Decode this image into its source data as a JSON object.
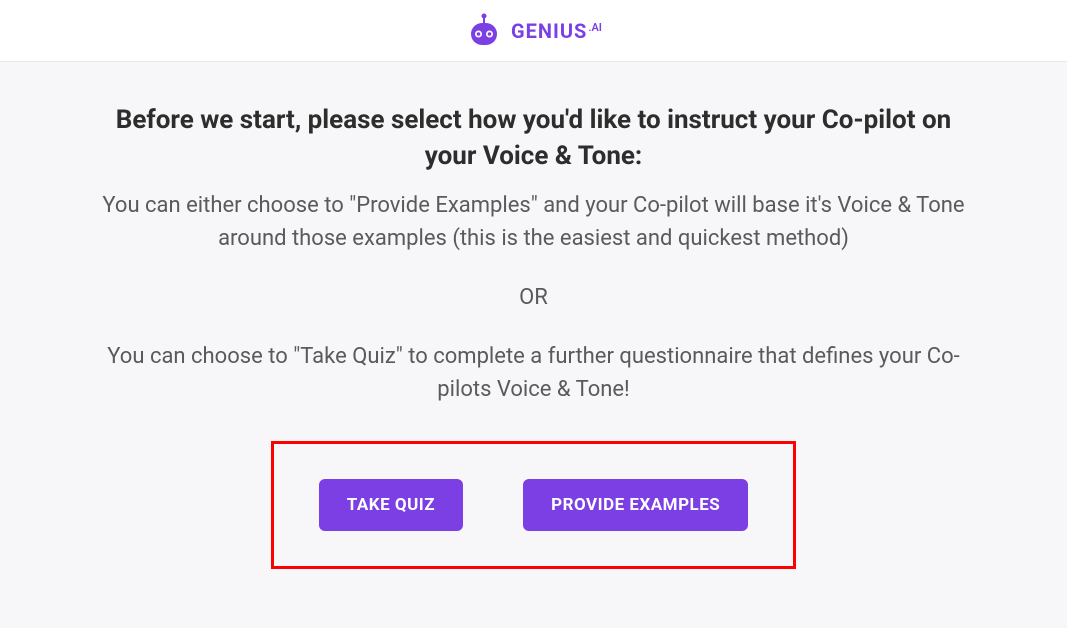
{
  "header": {
    "brand_name": "GENIUS",
    "brand_suffix": ".AI"
  },
  "content": {
    "heading": "Before we start, please select how you'd like to instruct your Co-pilot on your Voice & Tone:",
    "description1": "You can either choose to \"Provide Examples\" and your Co-pilot will base it's Voice & Tone around those examples (this is the easiest and quickest method)",
    "separator": "OR",
    "description2": "You can choose to \"Take Quiz\" to complete a further questionnaire that defines your Co-pilots Voice & Tone!"
  },
  "buttons": {
    "take_quiz": "TAKE QUIZ",
    "provide_examples": "PROVIDE EXAMPLES"
  },
  "colors": {
    "brand": "#7B3FE4",
    "highlight_border": "#ff0000"
  }
}
